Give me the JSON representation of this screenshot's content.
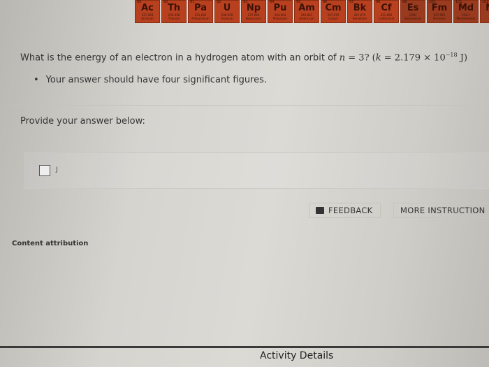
{
  "periodic_table": [
    {
      "num": "89",
      "sym": "Ac",
      "mass": "227.028",
      "name": "Actinium"
    },
    {
      "num": "90",
      "sym": "Th",
      "mass": "232.038",
      "name": "Thorium"
    },
    {
      "num": "91",
      "sym": "Pa",
      "mass": "231.036",
      "name": "Protactinium"
    },
    {
      "num": "92",
      "sym": "U",
      "mass": "238.029",
      "name": "Uranium"
    },
    {
      "num": "93",
      "sym": "Np",
      "mass": "237.048",
      "name": "Neptunium"
    },
    {
      "num": "94",
      "sym": "Pu",
      "mass": "244.064",
      "name": "Plutonium"
    },
    {
      "num": "95",
      "sym": "Am",
      "mass": "243.061",
      "name": "Americium"
    },
    {
      "num": "96",
      "sym": "Cm",
      "mass": "247.070",
      "name": "Curium"
    },
    {
      "num": "97",
      "sym": "Bk",
      "mass": "247.070",
      "name": "Berkelium"
    },
    {
      "num": "98",
      "sym": "Cf",
      "mass": "251.080",
      "name": "Californium"
    },
    {
      "num": "99",
      "sym": "Es",
      "mass": "(254)",
      "name": "Einsteinium"
    },
    {
      "num": "100",
      "sym": "Fm",
      "mass": "257.095",
      "name": "Fermium"
    },
    {
      "num": "101",
      "sym": "Md",
      "mass": "258.1",
      "name": "Mendelevium"
    },
    {
      "num": "102",
      "sym": "No",
      "mass": "",
      "name": ""
    }
  ],
  "question": {
    "text": "What is the energy of an electron in a hydrogen atom with an orbit of ",
    "n_var": "n",
    "n_eq": " = 3? (",
    "k_var": "k",
    "k_eq": " = 2.179 × 10",
    "k_exp": "−18",
    "k_unit": " J)",
    "bullet": "Your answer should have four significant figures."
  },
  "answer": {
    "prompt": "Provide your answer below:",
    "value": "",
    "unit": "J"
  },
  "buttons": {
    "feedback": "FEEDBACK",
    "more": "MORE INSTRUCTION"
  },
  "content_attribution": "Content attribution",
  "activity_details": "Activity Details"
}
